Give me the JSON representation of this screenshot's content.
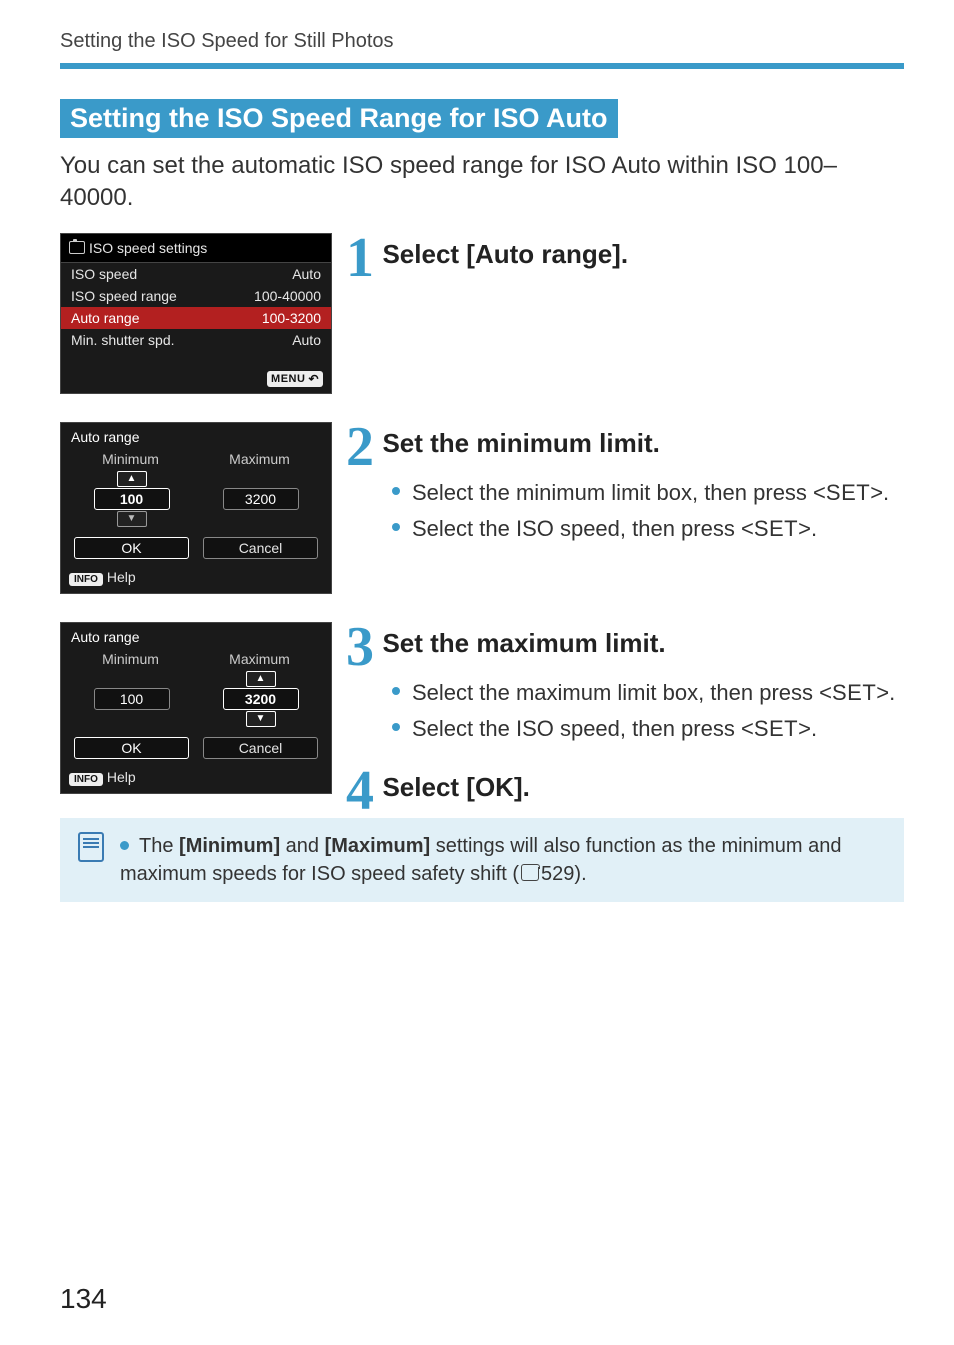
{
  "header": "Setting the ISO Speed for Still Photos",
  "section_title": "Setting the ISO Speed Range for ISO Auto",
  "intro": "You can set the automatic ISO speed range for ISO Auto within ISO 100–40000.",
  "page_number": "134",
  "set_label": "SET",
  "note": {
    "pre": "The ",
    "b1": "[Minimum]",
    "mid1": " and ",
    "b2": "[Maximum]",
    "mid2": " settings will also function as the minimum and maximum speeds for ISO speed safety shift (",
    "pageref": "529",
    "post": ")."
  },
  "steps": {
    "s1": {
      "num": "1",
      "head": "Select [Auto range]."
    },
    "s2": {
      "num": "2",
      "head": "Set the minimum limit.",
      "b1a": "Select the minimum limit box, then press <",
      "b1b": ">.",
      "b2a": "Select the ISO speed, then press <",
      "b2b": ">."
    },
    "s3": {
      "num": "3",
      "head": "Set the maximum limit.",
      "b1a": "Select the maximum limit box, then press <",
      "b1b": ">.",
      "b2a": "Select the ISO speed, then press <",
      "b2b": ">."
    },
    "s4": {
      "num": "4",
      "head": "Select [OK]."
    }
  },
  "cam1": {
    "title": "ISO speed settings",
    "menu": "MENU",
    "rows": [
      {
        "label": "ISO speed",
        "value": "Auto"
      },
      {
        "label": "ISO speed range",
        "value": "100-40000"
      },
      {
        "label": "Auto range",
        "value": "100-3200",
        "selected": true
      },
      {
        "label": "Min. shutter spd.",
        "value": "Auto"
      }
    ]
  },
  "cam2": {
    "title": "Auto range",
    "col_min": "Minimum",
    "col_max": "Maximum",
    "min_val": "100",
    "max_val": "3200",
    "ok": "OK",
    "cancel": "Cancel",
    "info": "INFO",
    "help": "Help"
  },
  "cam3": {
    "title": "Auto range",
    "col_min": "Minimum",
    "col_max": "Maximum",
    "min_val": "100",
    "max_val": "3200",
    "ok": "OK",
    "cancel": "Cancel",
    "info": "INFO",
    "help": "Help"
  }
}
